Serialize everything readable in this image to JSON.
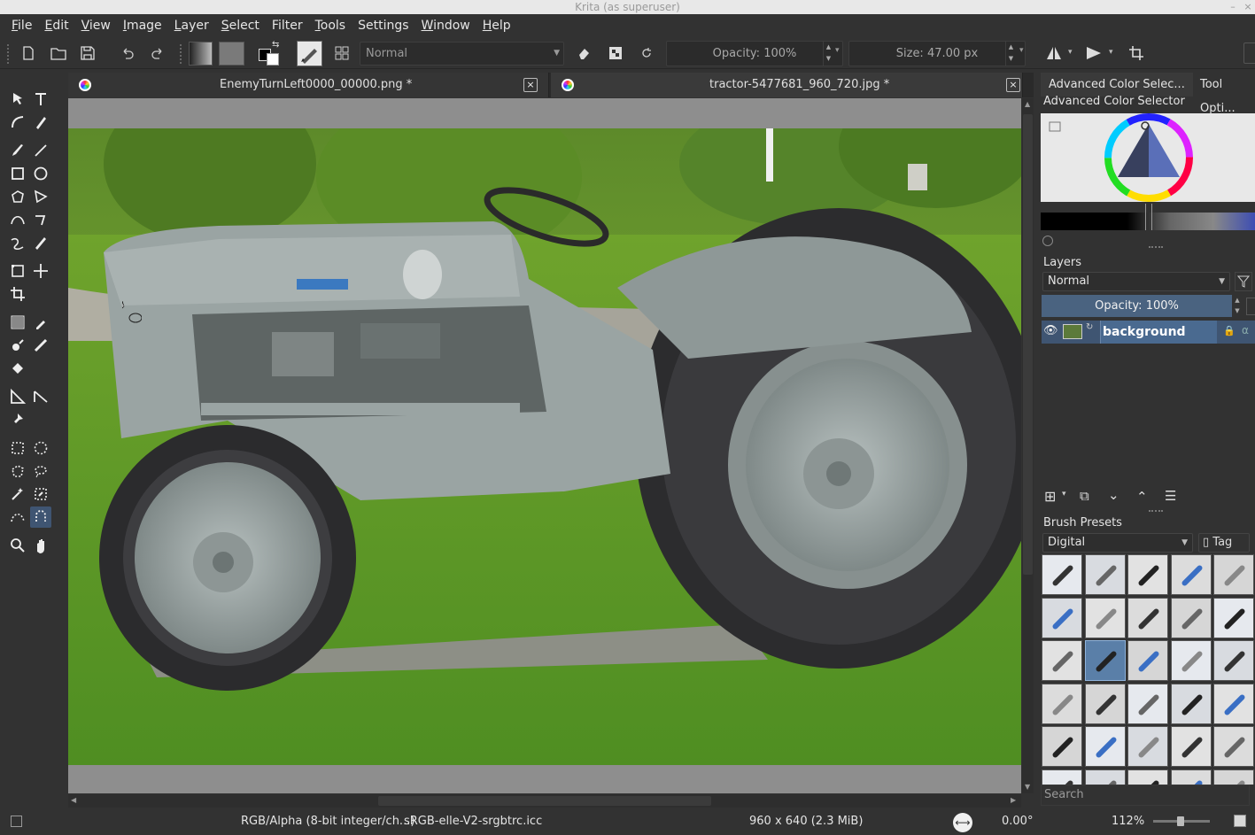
{
  "window": {
    "title": "Krita (as superuser)"
  },
  "menu": [
    {
      "label": "File",
      "u": "F",
      "rest": "ile"
    },
    {
      "label": "Edit",
      "u": "E",
      "rest": "dit"
    },
    {
      "label": "View",
      "u": "V",
      "rest": "iew"
    },
    {
      "label": "Image",
      "u": "I",
      "rest": "mage"
    },
    {
      "label": "Layer",
      "u": "L",
      "rest": "ayer"
    },
    {
      "label": "Select",
      "u": "S",
      "rest": "elect"
    },
    {
      "label": "Filter",
      "u": "",
      "rest": "Filter"
    },
    {
      "label": "Tools",
      "u": "T",
      "rest": "ools"
    },
    {
      "label": "Settings",
      "u": "",
      "rest": "Settings"
    },
    {
      "label": "Window",
      "u": "W",
      "rest": "indow"
    },
    {
      "label": "Help",
      "u": "H",
      "rest": "elp"
    }
  ],
  "toolbar": {
    "blend_mode": "Normal",
    "opacity": "Opacity: 100%",
    "size": "Size: 47.00 px"
  },
  "documents": {
    "tab1": "EnemyTurnLeft0000_00000.png *",
    "tab2": "tractor-5477681_960_720.jpg *"
  },
  "dock": {
    "tab_color": "Advanced Color Selec...",
    "tab_tool": "Tool Opti...",
    "color_title": "Advanced Color Selector",
    "layers_title": "Layers",
    "layers_blend": "Normal",
    "layers_opacity": "Opacity:  100%",
    "layer_name": "background",
    "presets_title": "Brush Presets",
    "presets_tag_combo": "Digital",
    "presets_tag_button": "Tag",
    "search_placeholder": "Search"
  },
  "status": {
    "color_model": "RGB/Alpha (8-bit integer/ch...)",
    "profile": "sRGB-elle-V2-srgbtrc.icc",
    "image_size": "960 x 640 (2.3 MiB)",
    "rotation": "0.00°",
    "zoom": "112%"
  },
  "colors": {
    "accent": "#3f5572",
    "panel": "#323232",
    "canvas_bg": "#8e8e8e"
  }
}
